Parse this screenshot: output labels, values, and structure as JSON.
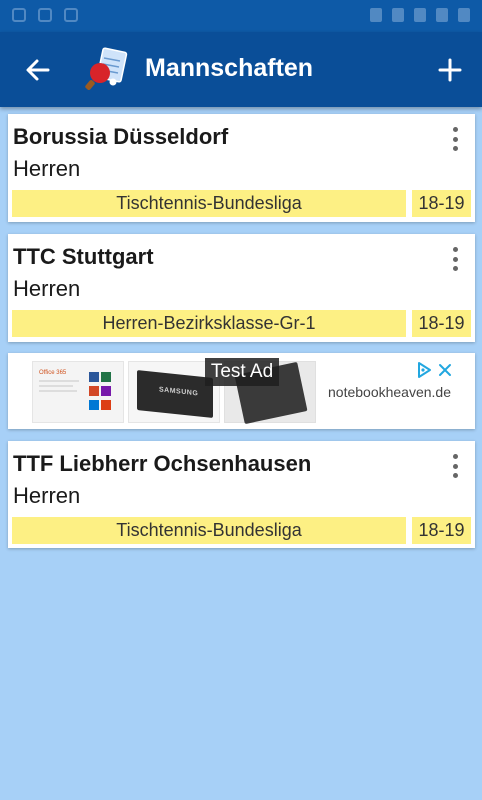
{
  "colors": {
    "appbar": "#0a4e98",
    "statusbar": "#0e5aa7",
    "background": "#a7d0f7",
    "league_badge": "#fdf084",
    "adchoices": "#22a7e0"
  },
  "appbar": {
    "title": "Mannschaften",
    "back_icon": "arrow-left-icon",
    "logo_icon": "table-tennis-logo-icon",
    "add_icon": "plus-icon"
  },
  "teams": [
    {
      "name": "Borussia Düsseldorf",
      "type": "Herren",
      "league": "Tischtennis-Bundesliga",
      "season": "18-19"
    },
    {
      "name": "TTC Stuttgart",
      "type": "Herren",
      "league": "Herren-Bezirksklasse-Gr-1",
      "season": "18-19"
    },
    {
      "name": "TTF Liebherr Ochsenhausen",
      "type": "Herren",
      "league": "Tischtennis-Bundesliga",
      "season": "18-19"
    }
  ],
  "ad": {
    "badge": "Test Ad",
    "domain": "notebookheaven.de",
    "ssd_brand": "SAMSUNG",
    "office_label": "Office 365"
  }
}
